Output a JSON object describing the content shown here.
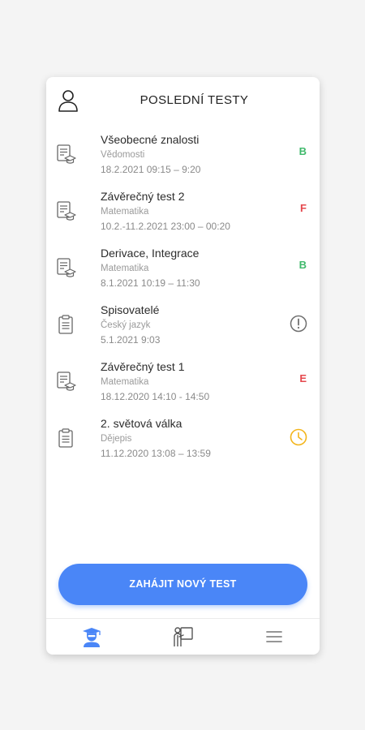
{
  "header": {
    "title": "POSLEDNÍ TESTY",
    "profile_icon": "user-icon"
  },
  "tests": [
    {
      "name": "Všeobecné znalosti",
      "subject": "Vědomosti",
      "date": "18.2.2021 09:15 – 9:20",
      "icon": "test-document-icon",
      "status_type": "grade",
      "grade": "B",
      "status_color": "#3fb96b"
    },
    {
      "name": "Závěrečný test 2",
      "subject": "Matematika",
      "date": "10.2.-11.2.2021 23:00 – 00:20",
      "icon": "test-document-icon",
      "status_type": "grade",
      "grade": "F",
      "status_color": "#e5484d"
    },
    {
      "name": "Derivace, Integrace",
      "subject": "Matematika",
      "date": "8.1.2021 10:19 – 11:30",
      "icon": "test-document-icon",
      "status_type": "grade",
      "grade": "B",
      "status_color": "#3fb96b"
    },
    {
      "name": "Spisovatelé",
      "subject": "Český jazyk",
      "date": "5.1.2021 9:03",
      "icon": "clipboard-icon",
      "status_type": "icon",
      "status_icon": "exclamation-circle-icon",
      "status_color": "#6f6f6f"
    },
    {
      "name": "Závěrečný test 1",
      "subject": "Matematika",
      "date": "18.12.2020 14:10 - 14:50",
      "icon": "test-document-icon",
      "status_type": "grade",
      "grade": "E",
      "status_color": "#e5484d"
    },
    {
      "name": "2. světová válka",
      "subject": "Dějepis",
      "date": "11.12.2020 13:08 – 13:59",
      "icon": "clipboard-icon",
      "status_type": "icon",
      "status_icon": "clock-icon",
      "status_color": "#f3b51b"
    }
  ],
  "cta": {
    "label": "ZAHÁJIT NOVÝ TEST"
  },
  "bottom_nav": {
    "items": [
      {
        "icon": "student-icon",
        "active": true,
        "color": "#4a86f7"
      },
      {
        "icon": "teacher-board-icon",
        "active": false,
        "color": "#555555"
      },
      {
        "icon": "menu-icon",
        "active": false,
        "color": "#888888"
      }
    ]
  },
  "colors": {
    "accent": "#4a86f7",
    "grade_good": "#3fb96b",
    "grade_bad": "#e5484d",
    "pending": "#f3b51b"
  }
}
